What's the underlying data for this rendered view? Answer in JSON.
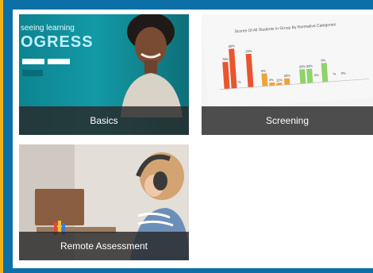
{
  "cards": [
    {
      "label": "Basics",
      "image_text_small": "seeing learning",
      "image_text_big": "OGRESS"
    },
    {
      "label": "Screening",
      "chart_title": "Scores Of All Students In Group By Normative Categories",
      "bar_labels": [
        "76%",
        "56%",
        "%",
        "20%",
        "5%",
        "4%",
        "11%",
        "25%",
        "25%",
        "33%",
        "0%",
        "0%",
        "%",
        "0%"
      ]
    },
    {
      "label": "Remote Assessment"
    }
  ],
  "colors": {
    "border_blue": "#0d6fa8",
    "accent_yellow": "#f3b21a",
    "label_bg": "#282828"
  }
}
